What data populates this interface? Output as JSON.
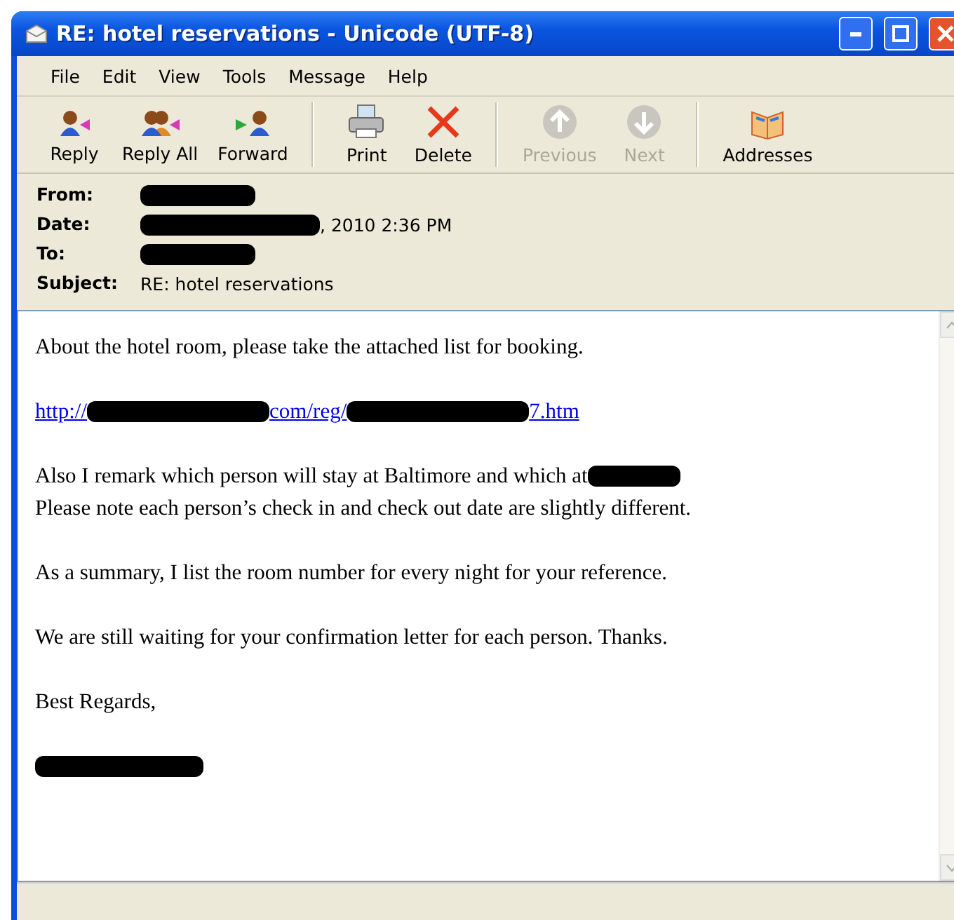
{
  "window": {
    "title": "RE: hotel reservations - Unicode (UTF-8)"
  },
  "menu": [
    "File",
    "Edit",
    "View",
    "Tools",
    "Message",
    "Help"
  ],
  "toolbar": [
    {
      "kind": "reply",
      "label": "Reply",
      "disabled": false
    },
    {
      "kind": "reply-all",
      "label": "Reply All",
      "disabled": false
    },
    {
      "kind": "forward",
      "label": "Forward",
      "disabled": false
    },
    {
      "kind": "separator"
    },
    {
      "kind": "print",
      "label": "Print",
      "disabled": false
    },
    {
      "kind": "delete",
      "label": "Delete",
      "disabled": false
    },
    {
      "kind": "separator"
    },
    {
      "kind": "previous",
      "label": "Previous",
      "disabled": true
    },
    {
      "kind": "next",
      "label": "Next",
      "disabled": true
    },
    {
      "kind": "separator"
    },
    {
      "kind": "addresses",
      "label": "Addresses",
      "disabled": false
    }
  ],
  "header": [
    {
      "label": "From:",
      "parts": [
        {
          "kind": "redacted"
        }
      ]
    },
    {
      "label": "Date:",
      "parts": [
        {
          "kind": "redacted"
        },
        {
          "kind": "text",
          "text": ", 2010 2:36 PM"
        }
      ]
    },
    {
      "label": "To:",
      "parts": [
        {
          "kind": "redacted"
        }
      ]
    },
    {
      "label": "Subject:",
      "parts": [
        {
          "kind": "text",
          "text": "RE: hotel reservations"
        }
      ]
    }
  ],
  "body": [
    {
      "lines": [
        {
          "kind": "text",
          "parts": [
            {
              "kind": "text",
              "text": "About the hotel room, please take the attached list for booking."
            }
          ]
        }
      ]
    },
    {
      "lines": [
        {
          "kind": "link",
          "parts": [
            {
              "kind": "text",
              "text": "http://"
            },
            {
              "kind": "redacted"
            },
            {
              "kind": "text",
              "text": "com/reg/"
            },
            {
              "kind": "redacted"
            },
            {
              "kind": "text",
              "text": "7.htm"
            }
          ]
        }
      ]
    },
    {
      "lines": [
        {
          "kind": "text",
          "parts": [
            {
              "kind": "text",
              "text": "Also I remark which person will stay at Baltimore and which at"
            },
            {
              "kind": "redacted"
            }
          ]
        },
        {
          "kind": "text",
          "parts": [
            {
              "kind": "text",
              "text": "Please note each person’s check in and check out date are slightly different."
            }
          ]
        }
      ]
    },
    {
      "lines": [
        {
          "kind": "text",
          "parts": [
            {
              "kind": "text",
              "text": "As a summary, I list the room number for every night for your reference."
            }
          ]
        }
      ]
    },
    {
      "lines": [
        {
          "kind": "text",
          "parts": [
            {
              "kind": "text",
              "text": "We are still waiting for your confirmation letter for each person. Thanks."
            }
          ]
        }
      ]
    },
    {
      "lines": [
        {
          "kind": "text",
          "parts": [
            {
              "kind": "text",
              "text": "Best Regards,"
            }
          ]
        }
      ]
    },
    {
      "lines": [
        {
          "kind": "text",
          "parts": [
            {
              "kind": "redacted"
            }
          ]
        }
      ]
    }
  ]
}
